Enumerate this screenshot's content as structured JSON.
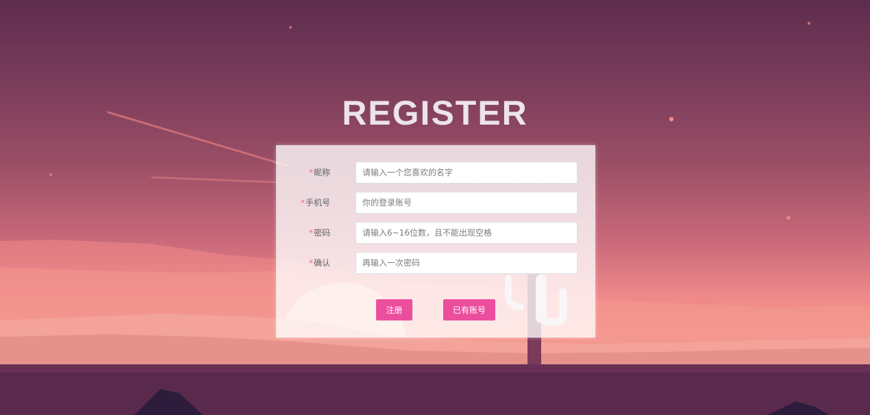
{
  "page": {
    "title": "REGISTER"
  },
  "form": {
    "nickname": {
      "required_mark": "*",
      "label": "昵称",
      "placeholder": "请输入一个您喜欢的名字",
      "value": ""
    },
    "phone": {
      "required_mark": "*",
      "label": "手机号",
      "placeholder": "你的登录账号",
      "value": ""
    },
    "password": {
      "required_mark": "*",
      "label": "密码",
      "placeholder": "请输入6~16位数，且不能出现空格",
      "value": ""
    },
    "confirm": {
      "required_mark": "*",
      "label": "确认",
      "placeholder": "再输入一次密码",
      "value": ""
    }
  },
  "actions": {
    "register_label": "注册",
    "has_account_label": "已有账号"
  },
  "colors": {
    "primary_button": "#eb4e9d",
    "required_mark": "#f56c6c",
    "sky_top": "#5e2c4e",
    "horizon": "#f08a8a"
  }
}
